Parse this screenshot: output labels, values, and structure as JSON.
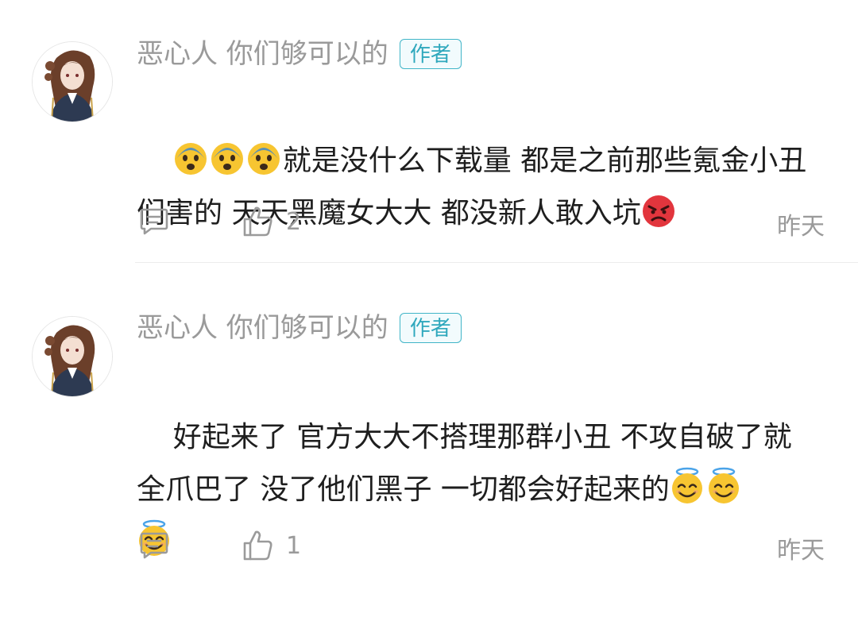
{
  "comments": [
    {
      "username": "恶心人 你们够可以的",
      "badge": "作者",
      "content_line1": "就是没什么下载量 都是之前那些氪金小丑",
      "content_line2": "们害的 天天黑魔女大大 都没新人敢入坑",
      "emoji_lead": [
        "anxious-face-icon",
        "anxious-face-icon",
        "anxious-face-icon"
      ],
      "emoji_trail": [
        "angry-face-icon"
      ],
      "likes": "2",
      "time": "昨天"
    },
    {
      "username": "恶心人 你们够可以的",
      "badge": "作者",
      "content_line1": "好起来了 官方大大不搭理那群小丑 不攻自破了就",
      "content_line2": "全爪巴了 没了他们黑子 一切都会好起来的",
      "emoji_trail": [
        "halo-smile-icon",
        "halo-smile-icon",
        "halo-smile-icon"
      ],
      "likes": "1",
      "time": "昨天"
    }
  ],
  "colors": {
    "muted_text": "#9a9a9a",
    "badge": "#41b5c8",
    "divider": "#ececec"
  }
}
